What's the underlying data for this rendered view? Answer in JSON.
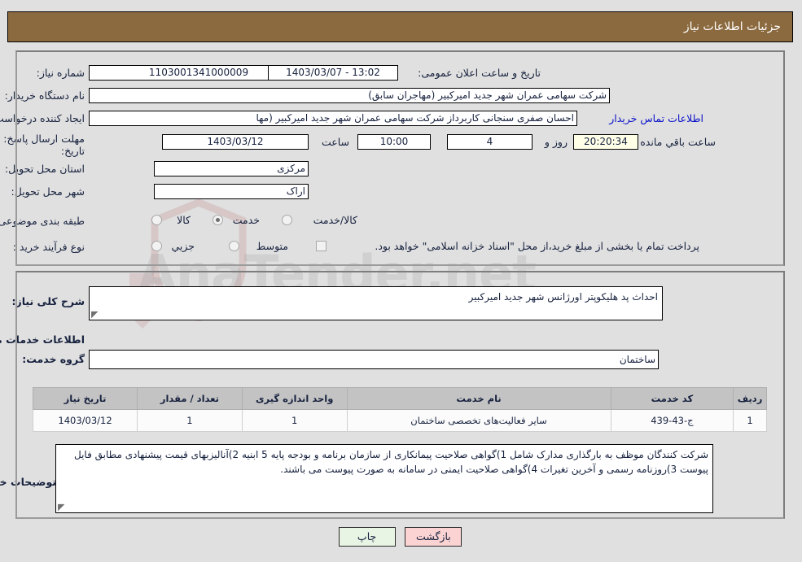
{
  "header": {
    "title": "جزئیات اطلاعات نیاز"
  },
  "form": {
    "need_number": {
      "label": "شماره نیاز:",
      "value": "1103001341000009"
    },
    "announce_datetime": {
      "label": "تاریخ و ساعت اعلان عمومی:",
      "value": "1403/03/07 - 13:02"
    },
    "buyer_org": {
      "label": "نام دستگاه خریدار:",
      "value": "شرکت سهامی عمران شهر جدید امیرکبیر (مهاجران سابق)"
    },
    "requester": {
      "label": "ایجاد کننده درخواست:",
      "value": "احسان صفری سنجانی کاربرداز شرکت سهامی عمران شهر جدید امیرکبیر (مها",
      "contact_link": "اطلاعات تماس خریدار"
    },
    "deadline": {
      "label_line1": "مهلت ارسال پاسخ: تا",
      "label_line2": "تاریخ:",
      "date": "1403/03/12",
      "hour_label": "ساعت",
      "hour": "10:00",
      "days": "4",
      "days_label": "روز و",
      "countdown": "20:20:34",
      "countdown_label": "ساعت باقي مانده"
    },
    "delivery_province": {
      "label": "استان محل تحویل:",
      "value": "مرکزی"
    },
    "delivery_city": {
      "label": "شهر محل تحویل:",
      "value": "اراک"
    },
    "category": {
      "label": "طبقه بندی موضوعی:",
      "options": [
        "کالا",
        "خدمت",
        "کالا/خدمت"
      ],
      "selected": "خدمت"
    },
    "purchase_type": {
      "label": "نوع فرآیند خرید :",
      "options": [
        "جزیي",
        "متوسط"
      ],
      "selected": "",
      "checkbox_note": "پرداخت تمام یا بخشی از مبلغ خرید،از محل \"اسناد خزانه اسلامی\" خواهد بود.",
      "checkbox_checked": false
    }
  },
  "details": {
    "general_desc": {
      "label": "شرح کلی نیاز:",
      "value": "احداث پد هلیکوپتر اورژانس شهر جدید امیرکبیر"
    },
    "services_heading": "اطلاعات خدمات مورد نیاز",
    "service_group": {
      "label": "گروه خدمت:",
      "value": "ساختمان"
    },
    "table": {
      "columns": [
        "ردیف",
        "کد خدمت",
        "نام خدمت",
        "واحد اندازه گیری",
        "تعداد / مقدار",
        "تاریخ نیاز"
      ],
      "rows": [
        {
          "radif": "1",
          "code": "ج-43-439",
          "name": "سایر فعالیت‌های تخصصی ساختمان",
          "unit": "1",
          "qty": "1",
          "date": "1403/03/12"
        }
      ]
    },
    "buyer_notes": {
      "label": "توضیحات خریدار:",
      "value": "شرکت کنندگان موظف به بارگذاری مدارک شامل 1)گواهی صلاحیت پیمانکاری از سازمان برنامه و بودجه پایه 5 ابنیه 2)آنالیزبهای قیمت پیشنهادی مطابق فایل پیوست 3)روزنامه رسمی و آخرین تغیرات 4)گواهی صلاحیت ایمنی در سامانه به صورت پیوست می باشند."
    }
  },
  "footer": {
    "print_label": "چاپ",
    "back_label": "بازگشت"
  },
  "watermark": {
    "text": "AnaTender.net"
  },
  "colors": {
    "header_bg": "#8c6a3f",
    "page_bg": "#e0e0e0",
    "link": "#0a12c8",
    "table_header_bg": "#c3c3c3",
    "print_btn_bg": "#e8f5e4",
    "back_btn_bg": "#fbd3d3",
    "countdown_bg": "#ffffe8"
  }
}
